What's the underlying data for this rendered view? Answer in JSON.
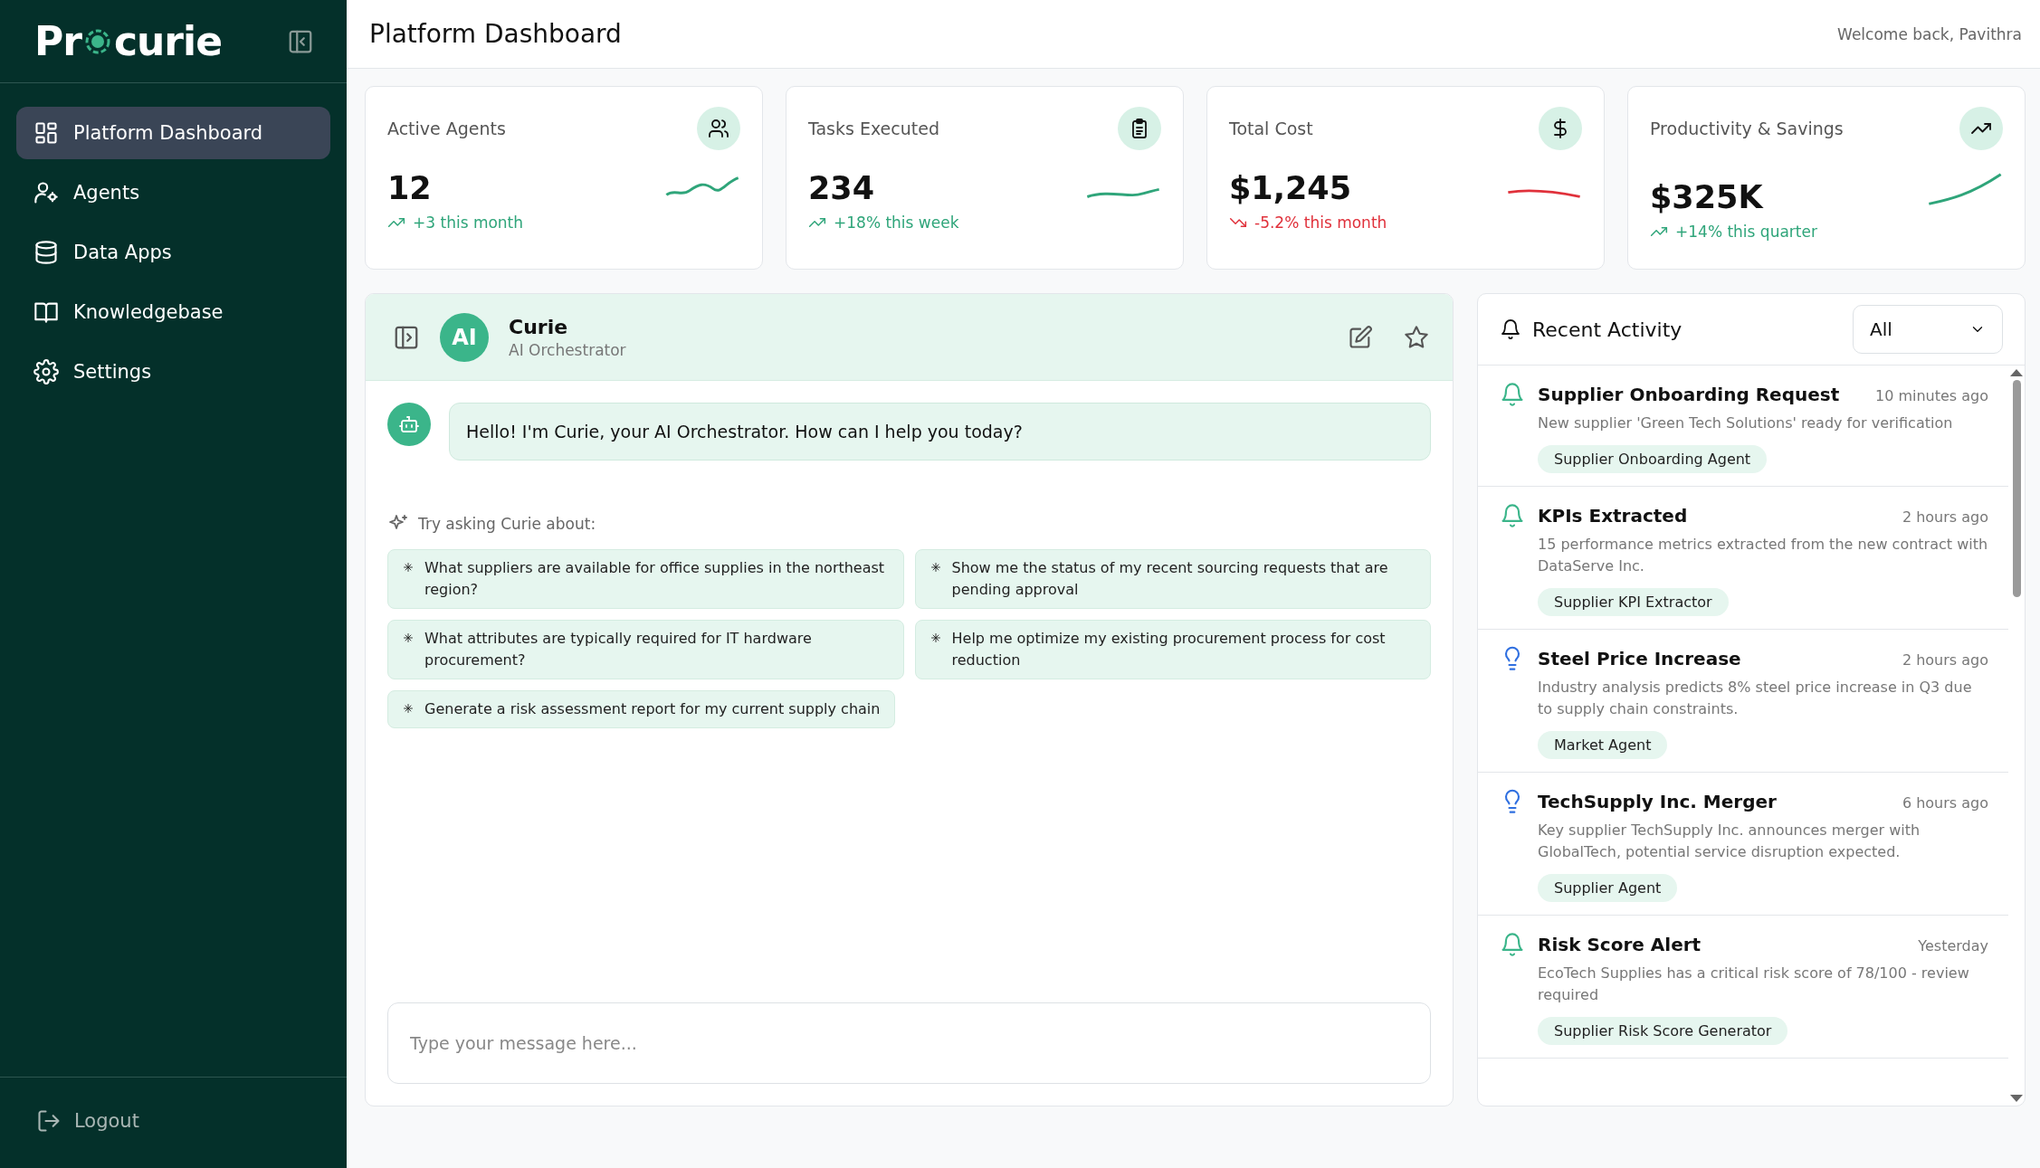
{
  "sidebar": {
    "logo": {
      "before": "Pr",
      "after": "curie"
    },
    "items": [
      {
        "label": "Platform Dashboard",
        "selected": true
      },
      {
        "label": "Agents",
        "selected": false
      },
      {
        "label": "Data Apps",
        "selected": false
      },
      {
        "label": "Knowledgebase",
        "selected": false
      },
      {
        "label": "Settings",
        "selected": false
      }
    ],
    "logout": "Logout"
  },
  "header": {
    "title": "Platform Dashboard",
    "welcome": "Welcome back, Pavithra"
  },
  "stats": [
    {
      "title": "Active Agents",
      "value": "12",
      "change": "+3 this month",
      "kind": "up"
    },
    {
      "title": "Tasks Executed",
      "value": "234",
      "change": "+18% this week",
      "kind": "up"
    },
    {
      "title": "Total Cost",
      "value": "$1,245",
      "change": "-5.2% this month",
      "kind": "down"
    },
    {
      "title": "Productivity & Savings",
      "value": "$325K",
      "change": "+14% this quarter",
      "kind": "up"
    }
  ],
  "chat": {
    "avatar": "AI",
    "name": "Curie",
    "role": "AI Orchestrator",
    "messages": [
      {
        "text": "Hello! I'm Curie, your AI Orchestrator. How can I help you today?"
      }
    ],
    "suggestions_label": "Try asking Curie about:",
    "suggestions": [
      "What suppliers are available for office supplies in the northeast region?",
      "Show me the status of my recent sourcing requests that are pending approval",
      "What attributes are typically required for IT hardware procurement?",
      "Help me optimize my existing procurement process for cost reduction",
      "Generate a risk assessment report for my current supply chain"
    ],
    "input": {
      "placeholder": "Type your message here..."
    }
  },
  "activity": {
    "title": "Recent Activity",
    "filter": "All",
    "items": [
      {
        "kind": "bell",
        "title": "Supplier Onboarding Request",
        "time": "10 minutes ago",
        "text": "New supplier 'Green Tech Solutions' ready for verification",
        "tag": "Supplier Onboarding Agent"
      },
      {
        "kind": "bell",
        "title": "KPIs Extracted",
        "time": "2 hours ago",
        "text": "15 performance metrics extracted from the new contract with DataServe Inc.",
        "tag": "Supplier KPI Extractor"
      },
      {
        "kind": "bulb",
        "title": "Steel Price Increase",
        "time": "2 hours ago",
        "text": "Industry analysis predicts 8% steel price increase in Q3 due to supply chain constraints.",
        "tag": "Market Agent"
      },
      {
        "kind": "bulb",
        "title": "TechSupply Inc. Merger",
        "time": "6 hours ago",
        "text": "Key supplier TechSupply Inc. announces merger with GlobalTech, potential service disruption expected.",
        "tag": "Supplier Agent"
      },
      {
        "kind": "bell",
        "title": "Risk Score Alert",
        "time": "Yesterday",
        "text": "EcoTech Supplies has a critical risk score of 78/100 - review required",
        "tag": "Supplier Risk Score Generator"
      }
    ]
  }
}
